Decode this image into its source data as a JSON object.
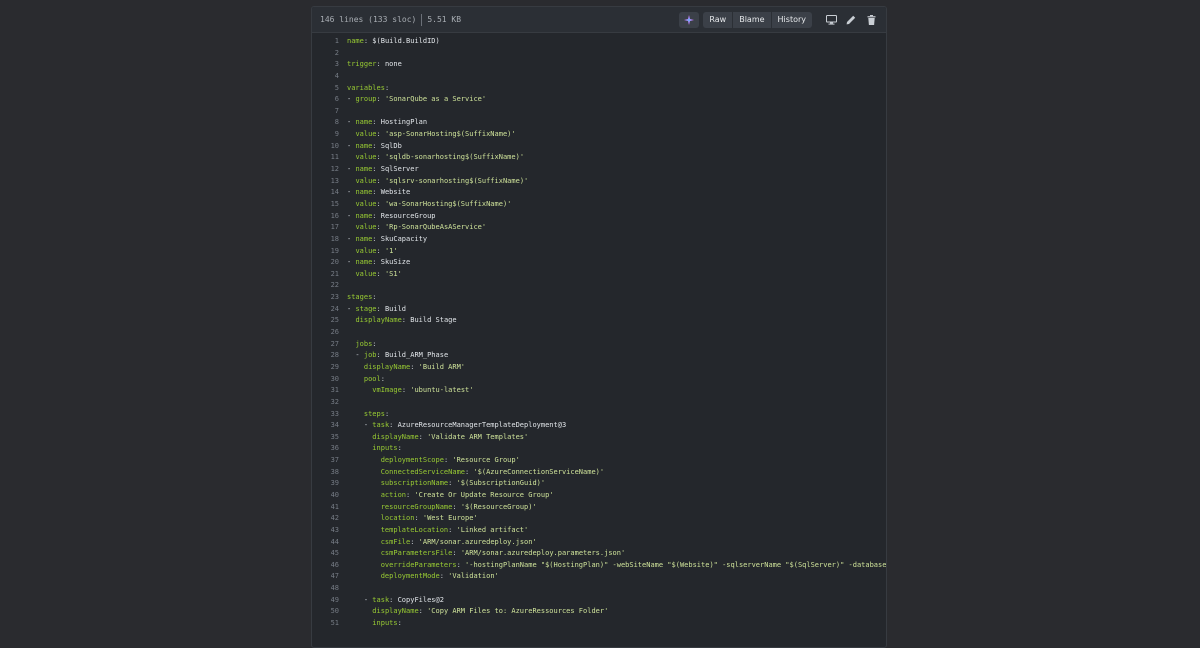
{
  "file_info": {
    "lines": "146 lines (133 sloc)",
    "size": "5.51 KB"
  },
  "toolbar": {
    "raw": "Raw",
    "blame": "Blame",
    "history": "History"
  },
  "icons": {
    "copilot": "sparkle-icon",
    "display": "desktop-icon",
    "edit": "pencil-icon",
    "delete": "trash-icon"
  },
  "colors": {
    "key": "#99cc33",
    "string": "#cfe39a",
    "line_number": "#757b84",
    "background": "#24272c"
  },
  "code_lines": [
    {
      "n": "1",
      "ind": "",
      "key": "name",
      "val": "$(Build.BuildID)"
    },
    {
      "n": "2",
      "ind": "",
      "key": "",
      "val": ""
    },
    {
      "n": "3",
      "ind": "",
      "key": "trigger",
      "val": "none"
    },
    {
      "n": "4",
      "ind": "",
      "key": "",
      "val": ""
    },
    {
      "n": "5",
      "ind": "",
      "key": "variables",
      "val": ""
    },
    {
      "n": "6",
      "ind": "- ",
      "key": "group",
      "val": "'SonarQube as a Service'"
    },
    {
      "n": "7",
      "ind": "",
      "key": "",
      "val": ""
    },
    {
      "n": "8",
      "ind": "- ",
      "key": "name",
      "val": "HostingPlan"
    },
    {
      "n": "9",
      "ind": "  ",
      "key": "value",
      "val": "'asp-SonarHosting$(SuffixName)'"
    },
    {
      "n": "10",
      "ind": "- ",
      "key": "name",
      "val": "SqlDb"
    },
    {
      "n": "11",
      "ind": "  ",
      "key": "value",
      "val": "'sqldb-sonarhosting$(SuffixName)'"
    },
    {
      "n": "12",
      "ind": "- ",
      "key": "name",
      "val": "SqlServer"
    },
    {
      "n": "13",
      "ind": "  ",
      "key": "value",
      "val": "'sqlsrv-sonarhosting$(SuffixName)'"
    },
    {
      "n": "14",
      "ind": "- ",
      "key": "name",
      "val": "Website"
    },
    {
      "n": "15",
      "ind": "  ",
      "key": "value",
      "val": "'wa-SonarHosting$(SuffixName)'"
    },
    {
      "n": "16",
      "ind": "- ",
      "key": "name",
      "val": "ResourceGroup"
    },
    {
      "n": "17",
      "ind": "  ",
      "key": "value",
      "val": "'Rp-SonarQubeAsAService'"
    },
    {
      "n": "18",
      "ind": "- ",
      "key": "name",
      "val": "SkuCapacity"
    },
    {
      "n": "19",
      "ind": "  ",
      "key": "value",
      "val": "'1'"
    },
    {
      "n": "20",
      "ind": "- ",
      "key": "name",
      "val": "SkuSize"
    },
    {
      "n": "21",
      "ind": "  ",
      "key": "value",
      "val": "'S1'"
    },
    {
      "n": "22",
      "ind": "",
      "key": "",
      "val": ""
    },
    {
      "n": "23",
      "ind": "",
      "key": "stages",
      "val": ""
    },
    {
      "n": "24",
      "ind": "- ",
      "key": "stage",
      "val": "Build"
    },
    {
      "n": "25",
      "ind": "  ",
      "key": "displayName",
      "val": "Build Stage"
    },
    {
      "n": "26",
      "ind": "",
      "key": "",
      "val": ""
    },
    {
      "n": "27",
      "ind": "  ",
      "key": "jobs",
      "val": ""
    },
    {
      "n": "28",
      "ind": "  - ",
      "key": "job",
      "val": "Build_ARM_Phase"
    },
    {
      "n": "29",
      "ind": "    ",
      "key": "displayName",
      "val": "'Build ARM'"
    },
    {
      "n": "30",
      "ind": "    ",
      "key": "pool",
      "val": ""
    },
    {
      "n": "31",
      "ind": "      ",
      "key": "vmImage",
      "val": "'ubuntu-latest'"
    },
    {
      "n": "32",
      "ind": "",
      "key": "",
      "val": ""
    },
    {
      "n": "33",
      "ind": "    ",
      "key": "steps",
      "val": ""
    },
    {
      "n": "34",
      "ind": "    - ",
      "key": "task",
      "val": "AzureResourceManagerTemplateDeployment@3"
    },
    {
      "n": "35",
      "ind": "      ",
      "key": "displayName",
      "val": "'Validate ARM Templates'"
    },
    {
      "n": "36",
      "ind": "      ",
      "key": "inputs",
      "val": ""
    },
    {
      "n": "37",
      "ind": "        ",
      "key": "deploymentScope",
      "val": "'Resource Group'"
    },
    {
      "n": "38",
      "ind": "        ",
      "key": "ConnectedServiceName",
      "val": "'$(AzureConnectionServiceName)'"
    },
    {
      "n": "39",
      "ind": "        ",
      "key": "subscriptionName",
      "val": "'$(SubscriptionGuid)'"
    },
    {
      "n": "40",
      "ind": "        ",
      "key": "action",
      "val": "'Create Or Update Resource Group'"
    },
    {
      "n": "41",
      "ind": "        ",
      "key": "resourceGroupName",
      "val": "'$(ResourceGroup)'"
    },
    {
      "n": "42",
      "ind": "        ",
      "key": "location",
      "val": "'West Europe'"
    },
    {
      "n": "43",
      "ind": "        ",
      "key": "templateLocation",
      "val": "'Linked artifact'"
    },
    {
      "n": "44",
      "ind": "        ",
      "key": "csmFile",
      "val": "'ARM/sonar.azuredeploy.json'"
    },
    {
      "n": "45",
      "ind": "        ",
      "key": "csmParametersFile",
      "val": "'ARM/sonar.azuredeploy.parameters.json'"
    },
    {
      "n": "46",
      "ind": "        ",
      "key": "overrideParameters",
      "val": "'-hostingPlanName \"$(HostingPlan)\" -webSiteName \"$(Website)\" -sqlserverName \"$(SqlServer)\" -databaseName \"$(Sql"
    },
    {
      "n": "47",
      "ind": "        ",
      "key": "deploymentMode",
      "val": "'Validation'"
    },
    {
      "n": "48",
      "ind": "",
      "key": "",
      "val": ""
    },
    {
      "n": "49",
      "ind": "    - ",
      "key": "task",
      "val": "CopyFiles@2"
    },
    {
      "n": "50",
      "ind": "      ",
      "key": "displayName",
      "val": "'Copy ARM Files to: AzureRessources Folder'"
    },
    {
      "n": "51",
      "ind": "      ",
      "key": "inputs",
      "val": ""
    }
  ]
}
